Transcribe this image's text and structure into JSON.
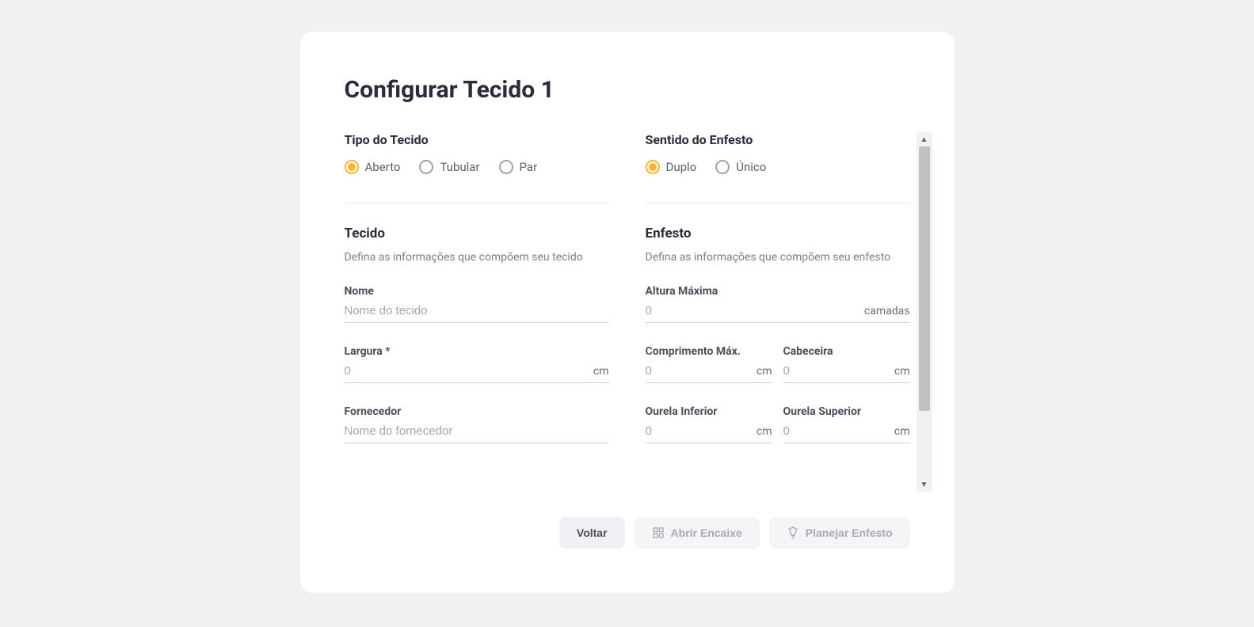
{
  "page_title": "Configurar Tecido 1",
  "left": {
    "tipo_title": "Tipo do Tecido",
    "tipo_options": [
      {
        "label": "Aberto",
        "checked": true
      },
      {
        "label": "Tubular",
        "checked": false
      },
      {
        "label": "Par",
        "checked": false
      }
    ],
    "tecido_title": "Tecido",
    "tecido_desc": "Defina as informações que compõem seu tecido",
    "fields": {
      "nome_label": "Nome",
      "nome_placeholder": "Nome do tecido",
      "largura_label": "Largura *",
      "largura_placeholder": "0",
      "largura_unit": "cm",
      "fornecedor_label": "Fornecedor",
      "fornecedor_placeholder": "Nome do fornecedor"
    }
  },
  "right": {
    "sentido_title": "Sentido do Enfesto",
    "sentido_options": [
      {
        "label": "Duplo",
        "checked": true
      },
      {
        "label": "Único",
        "checked": false
      }
    ],
    "enfesto_title": "Enfesto",
    "enfesto_desc": "Defina as informações que compõem seu enfesto",
    "fields": {
      "altura_label": "Altura Máxima",
      "altura_placeholder": "0",
      "altura_unit": "camadas",
      "comprimento_label": "Comprimento Máx.",
      "comprimento_placeholder": "0",
      "comprimento_unit": "cm",
      "cabeceira_label": "Cabeceira",
      "cabeceira_placeholder": "0",
      "cabeceira_unit": "cm",
      "ourela_inf_label": "Ourela Inferior",
      "ourela_inf_placeholder": "0",
      "ourela_inf_unit": "cm",
      "ourela_sup_label": "Ourela Superior",
      "ourela_sup_placeholder": "0",
      "ourela_sup_unit": "cm"
    }
  },
  "footer": {
    "voltar": "Voltar",
    "abrir_encaixe": "Abrir Encaixe",
    "planejar_enfesto": "Planejar Enfesto"
  }
}
